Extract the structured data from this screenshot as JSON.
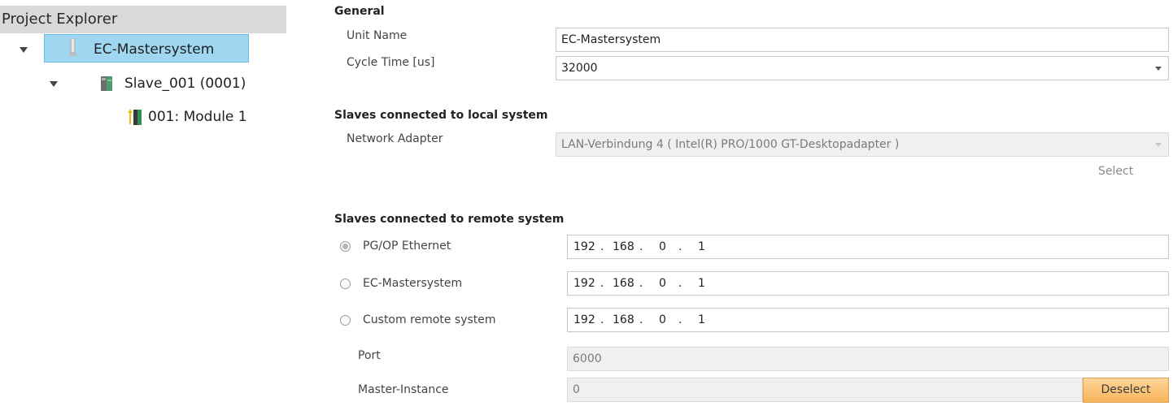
{
  "explorer": {
    "title": "Project Explorer",
    "nodes": [
      {
        "label": "EC-Mastersystem"
      },
      {
        "label": "Slave_001 (0001)"
      },
      {
        "label": "001: Module 1"
      }
    ]
  },
  "general": {
    "title": "General",
    "unit_name_label": "Unit Name",
    "unit_name_value": "EC-Mastersystem",
    "cycle_time_label": "Cycle Time [us]",
    "cycle_time_value": "32000"
  },
  "local": {
    "title": "Slaves connected to local system",
    "network_adapter_label": "Network Adapter",
    "network_adapter_value": "LAN-Verbindung 4 ( Intel(R) PRO/1000 GT-Desktopadapter )",
    "select_label": "Select"
  },
  "remote": {
    "title": "Slaves connected to remote system",
    "options": [
      {
        "label": "PG/OP Ethernet",
        "ip": [
          "192",
          "168",
          "0",
          "1"
        ],
        "selected": true
      },
      {
        "label": "EC-Mastersystem",
        "ip": [
          "192",
          "168",
          "0",
          "1"
        ],
        "selected": false
      },
      {
        "label": "Custom remote system",
        "ip": [
          "192",
          "168",
          "0",
          "1"
        ],
        "selected": false
      }
    ],
    "port_label": "Port",
    "port_value": "6000",
    "master_instance_label": "Master-Instance",
    "master_instance_value": "0",
    "deselect_label": "Deselect"
  },
  "colors": {
    "selection": "#9fd7f1",
    "button_accent": "#f7b45a"
  }
}
